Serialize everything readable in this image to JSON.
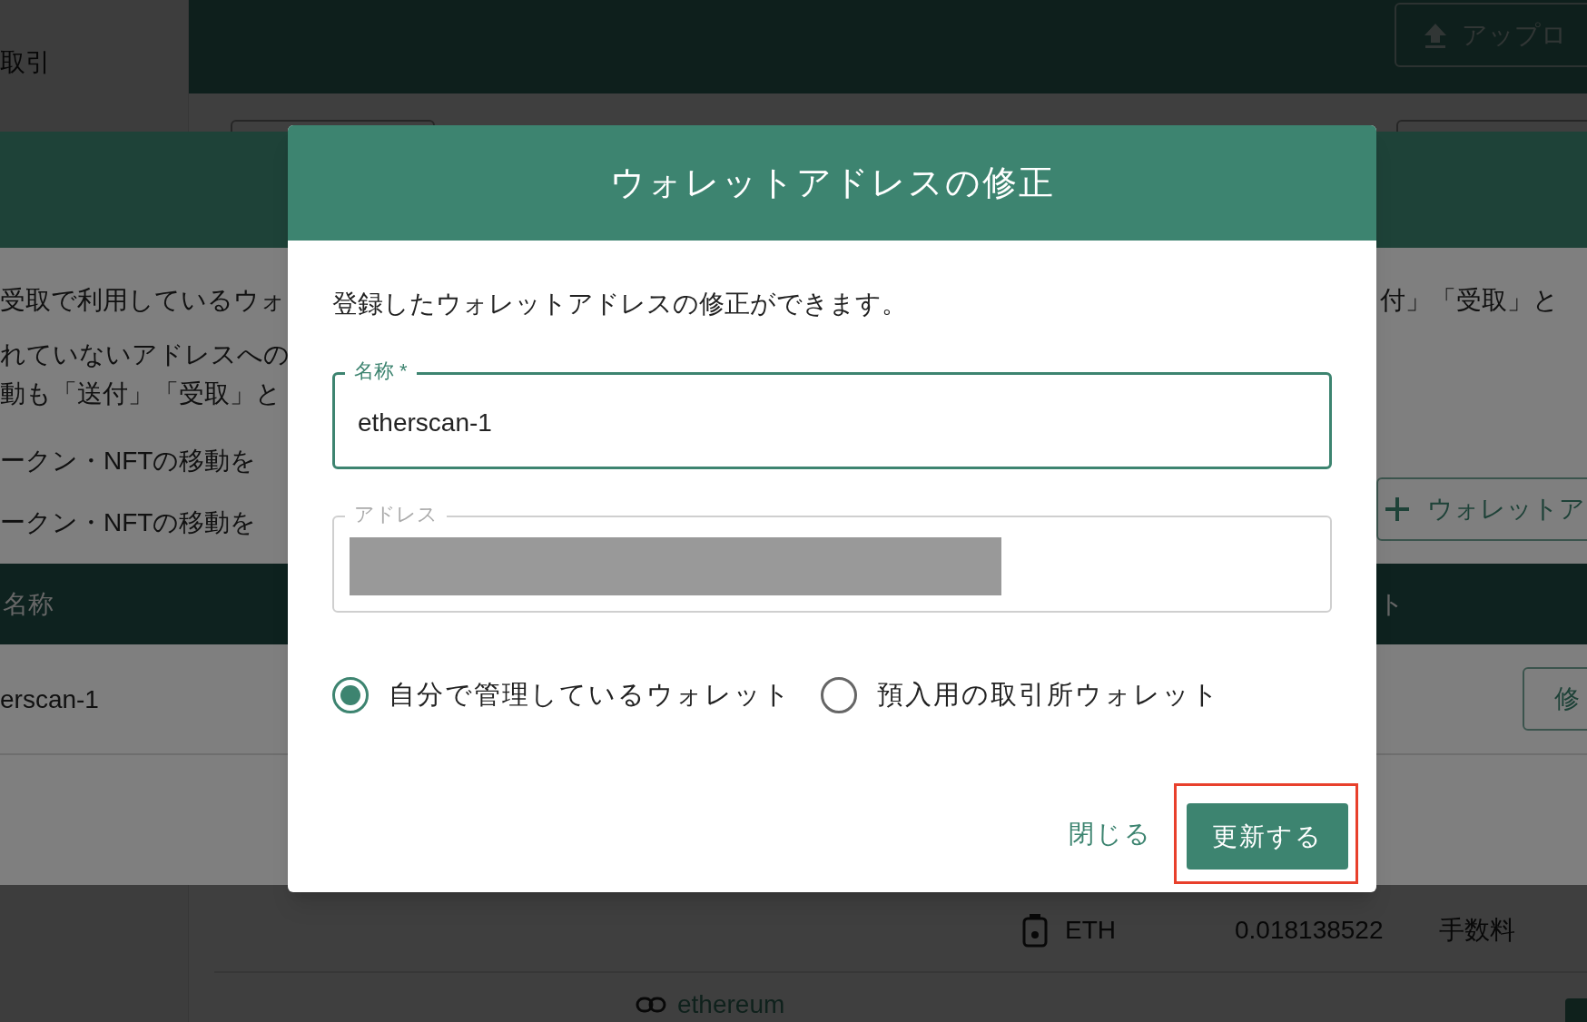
{
  "sidebar": {
    "items": [
      {
        "label": "取引"
      }
    ]
  },
  "header": {
    "upload_button": "アップロ"
  },
  "page_rows": [
    {
      "asset": "ETH",
      "amount": "0.018138522",
      "type": "手数料"
    }
  ],
  "page_link": "ethereum",
  "background_dialog": {
    "left_lines": [
      "受取で利用しているウォ",
      "れていないアドレスへの",
      "動も「送付」「受取」と",
      "ークン・NFTの移動を",
      "ークン・NFTの移動を"
    ],
    "right_lines": [
      "付」「受取」と"
    ],
    "add_button": "ウォレットア",
    "table": {
      "header_left": "名称",
      "header_right": "ト",
      "row_left": "erscan-1",
      "row_button": "修"
    }
  },
  "dialog": {
    "title": "ウォレットアドレスの修正",
    "description": "登録したウォレットアドレスの修正ができます。",
    "fields": [
      {
        "label": "名称 *",
        "value": "etherscan-1",
        "focused": true,
        "redacted": false
      },
      {
        "label": "アドレス",
        "focused": false,
        "redacted": true
      }
    ],
    "wallet_type": [
      {
        "label": "自分で管理しているウォレット",
        "selected": true
      },
      {
        "label": "預入用の取引所ウォレット",
        "selected": false
      }
    ],
    "buttons": [
      {
        "label": "閉じる",
        "kind": "text",
        "highlighted": false
      },
      {
        "label": "更新する",
        "kind": "primary",
        "highlighted": true
      }
    ]
  }
}
